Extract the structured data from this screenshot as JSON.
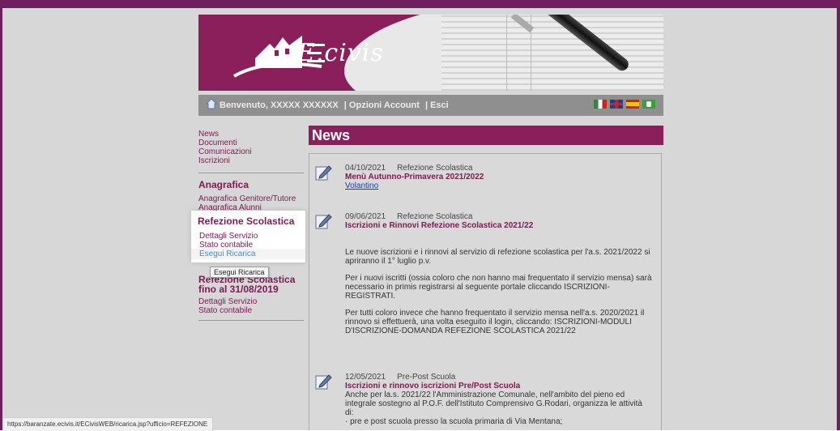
{
  "header": {
    "logo_text": "E.civis",
    "welcome": "Benvenuto, XXXXX  XXXXXX",
    "account_options": "| Opzioni Account",
    "exit": "| Esci"
  },
  "sidebar": {
    "top_links": [
      "News",
      "Documenti",
      "Comunicazioni",
      "Iscrizioni"
    ],
    "anagrafica": {
      "title": "Anagrafica",
      "links": [
        "Anagrafica Genitore/Tutore",
        "Anagrafica Alunni"
      ]
    },
    "refezione": {
      "title": "Refezione Scolastica",
      "links": [
        "Dettagli Servizio",
        "Stato contabile",
        "Esegui Ricarica"
      ]
    },
    "refezione_old": {
      "title_line1": "Refezione Scolastica",
      "title_line2": "fino al 31/08/2019",
      "links": [
        "Dettagli Servizio",
        "Stato contabile"
      ]
    },
    "tooltip": "Esegui Ricarica"
  },
  "main": {
    "title": "News",
    "items": [
      {
        "date": "04/10/2021",
        "category": "Refezione Scolastica",
        "title": "Menù Autunno-Primavera 2021/2022",
        "link": "Volantino"
      },
      {
        "date": "09/06/2021",
        "category": "Refezione Scolastica",
        "title": "Iscrizioni e Rinnovi Refezione Scolastica 2021/22",
        "p1": "Le nuove iscrizioni e i rinnovi al servizio di refezione scolastica per l'a.s. 2021/2022 si apriranno il 1° luglio p.v.",
        "p2": "Per i nuovi iscritti (ossia coloro che non hanno mai frequentato il servizio mensa) sarà necessario in primis registrarsi al seguente portale cliccando ISCRIZIONI-REGISTRATI.",
        "p3": "Per tutti coloro invece che hanno frequentato il servizio mensa nell'a.s. 2020/2021 il rinnovo si effettuerà, una volta eseguito il login, cliccando: ISCRIZIONI-MODULI D'ISCRIZIONE-DOMANDA REFEZIONE SCOLASTICA 2021/22"
      },
      {
        "date": "12/05/2021",
        "category": "Pre-Post Scuola",
        "title": "Iscrizioni e rinnovo iscrizioni Pre/Post Scuola",
        "p1": "Anche per la.s. 2021/22 l'Amministrazione Comunale, nell'ambito del pieno ed integrale sostegno al P.O.F. dell'Istituto Comprensivo G.Rodari, organizza le attività di:",
        "p2": "· pre e post scuola presso la scuola primaria di Via Mentana;"
      }
    ]
  },
  "status_url": "https://baranzate.ecivis.it/ECivisWEB/ricarica.jsp?ufficio=REFEZIONE",
  "colors": {
    "brand": "#8b1f5c",
    "link": "#7a1a52",
    "active_link": "#3a8fd0"
  },
  "icons": [
    "home-icon",
    "flag-italy-icon",
    "flag-uk-icon",
    "flag-spain-icon",
    "flag-green-icon",
    "news-edit-icon"
  ]
}
